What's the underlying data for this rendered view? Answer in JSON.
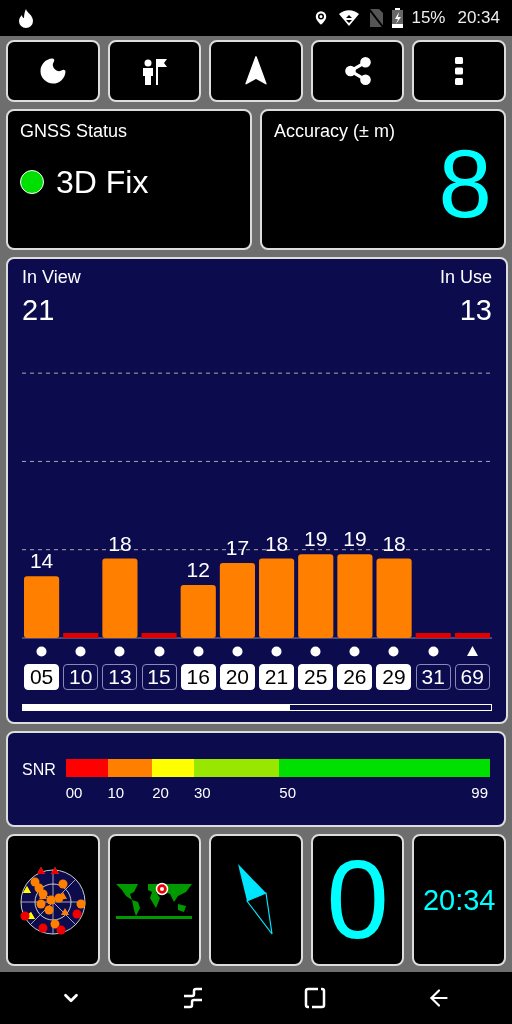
{
  "status_bar": {
    "battery": "15%",
    "time": "20:34"
  },
  "gnss_status": {
    "title": "GNSS Status",
    "value": "3D Fix"
  },
  "accuracy": {
    "title": "Accuracy (± m)",
    "value": "8"
  },
  "satellites_panel": {
    "in_view_label": "In View",
    "in_view": "21",
    "in_use_label": "In Use",
    "in_use": "13",
    "chart_data": {
      "type": "bar",
      "categories": [
        "05",
        "10",
        "13",
        "15",
        "16",
        "20",
        "21",
        "25",
        "26",
        "29",
        "31",
        "69"
      ],
      "values": [
        14,
        null,
        18,
        null,
        12,
        17,
        18,
        19,
        19,
        18,
        null,
        null
      ],
      "data_labels": true
    },
    "satellites": [
      {
        "used": true,
        "kind": "circle"
      },
      {
        "used": false,
        "kind": "circle"
      },
      {
        "used": false,
        "kind": "circle"
      },
      {
        "used": false,
        "kind": "circle"
      },
      {
        "used": true,
        "kind": "circle"
      },
      {
        "used": true,
        "kind": "circle"
      },
      {
        "used": true,
        "kind": "circle"
      },
      {
        "used": true,
        "kind": "circle"
      },
      {
        "used": true,
        "kind": "circle"
      },
      {
        "used": true,
        "kind": "circle"
      },
      {
        "used": false,
        "kind": "circle"
      },
      {
        "used": false,
        "kind": "triangle"
      }
    ]
  },
  "snr": {
    "label": "SNR",
    "segments": [
      {
        "color": "#ff0000",
        "label": "00"
      },
      {
        "color": "#ff8000",
        "label": "10"
      },
      {
        "color": "#ffff00",
        "label": "20"
      },
      {
        "color": "#99e600",
        "label": "30"
      },
      {
        "color": "#00e000",
        "label": "50"
      }
    ],
    "end_label": "99"
  },
  "widgets": {
    "speed": "0",
    "clock": "20:34"
  }
}
